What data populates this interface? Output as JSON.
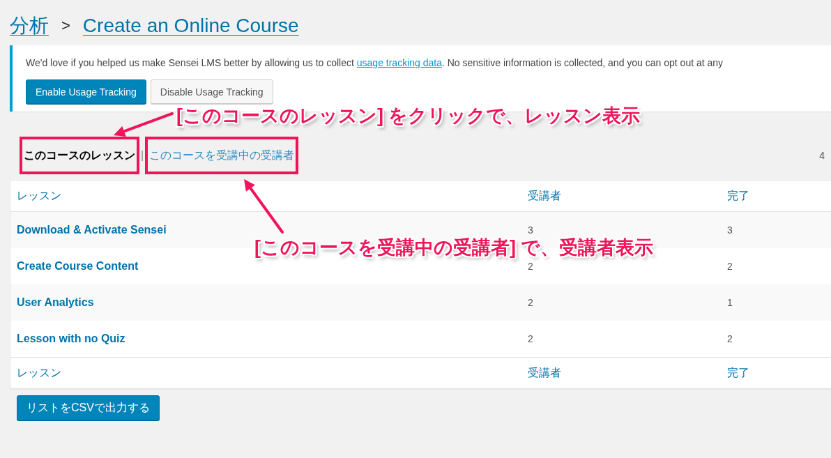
{
  "breadcrumb": {
    "parent": "分析",
    "separator": ">",
    "current": "Create an Online Course"
  },
  "notice": {
    "text_before": "We'd love if you helped us make Sensei LMS better by allowing us to collect ",
    "link": "usage tracking data",
    "text_after": ". No sensitive information is collected, and you can opt out at any",
    "buttons": [
      {
        "label": "Enable Usage Tracking",
        "kind": "primary"
      },
      {
        "label": "Disable Usage Tracking",
        "kind": "secondary"
      }
    ]
  },
  "view_tabs": [
    {
      "label": "このコースのレッスン",
      "selected": true,
      "highlighted": true
    },
    {
      "label": "このコースを受講中の受講者",
      "selected": false,
      "highlighted": true
    }
  ],
  "tab_separator": "|",
  "item_count": "4",
  "table": {
    "columns": [
      "レッスン",
      "受講者",
      "完了"
    ],
    "rows": [
      {
        "lesson": "Download & Activate Sensei",
        "students": "3",
        "completed": "3"
      },
      {
        "lesson": "Create Course Content",
        "students": "2",
        "completed": "2"
      },
      {
        "lesson": "User Analytics",
        "students": "2",
        "completed": "1"
      },
      {
        "lesson": "Lesson with no Quiz",
        "students": "2",
        "completed": "2"
      }
    ],
    "footer_columns": [
      "レッスン",
      "受講者",
      "完了"
    ]
  },
  "export_button": "リストをCSVで出力する",
  "annotations": [
    {
      "text": "[このコースのレッスン] をクリックで、レッスン表示"
    },
    {
      "text": "[このコースを受講中の受講者] で、受講者表示"
    }
  ]
}
